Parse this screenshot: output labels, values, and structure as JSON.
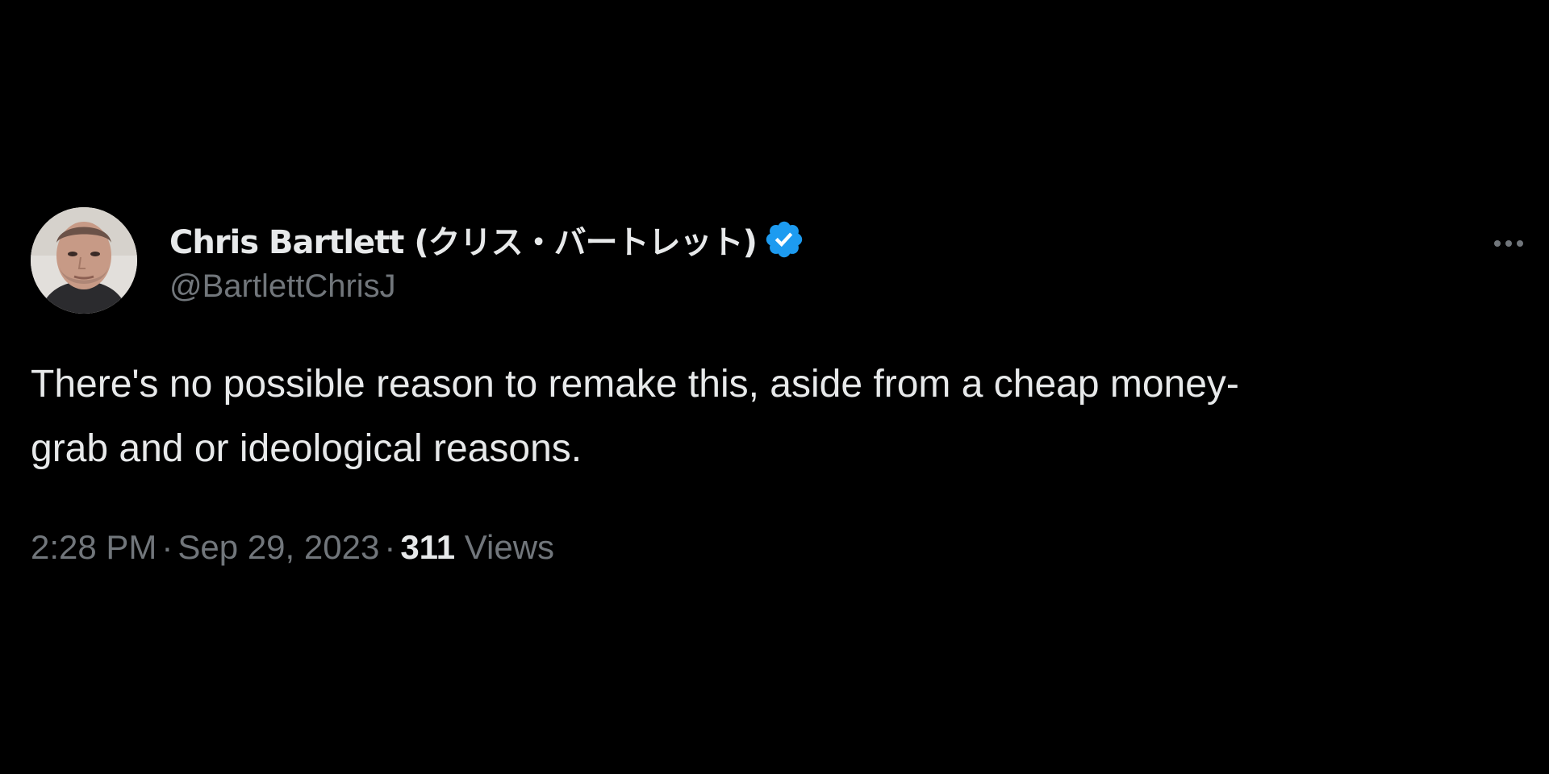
{
  "tweet": {
    "author": {
      "display_name": "Chris Bartlett (クリス・バートレット)",
      "handle": "@BartlettChrisJ",
      "verified": true,
      "avatar_icon": "profile-photo"
    },
    "more_icon": "more-horizontal-icon",
    "text_lines": [
      "There's no possible reason to remake this, aside from a cheap money-",
      "grab and or ideological reasons."
    ],
    "meta": {
      "time": "2:28 PM",
      "separator": "·",
      "date": "Sep 29, 2023",
      "views_count": "311",
      "views_label": "Views"
    }
  },
  "colors": {
    "background": "#000000",
    "primary_text": "#e7e9ea",
    "secondary_text": "#71767b",
    "verified_blue": "#1d9bf0"
  }
}
